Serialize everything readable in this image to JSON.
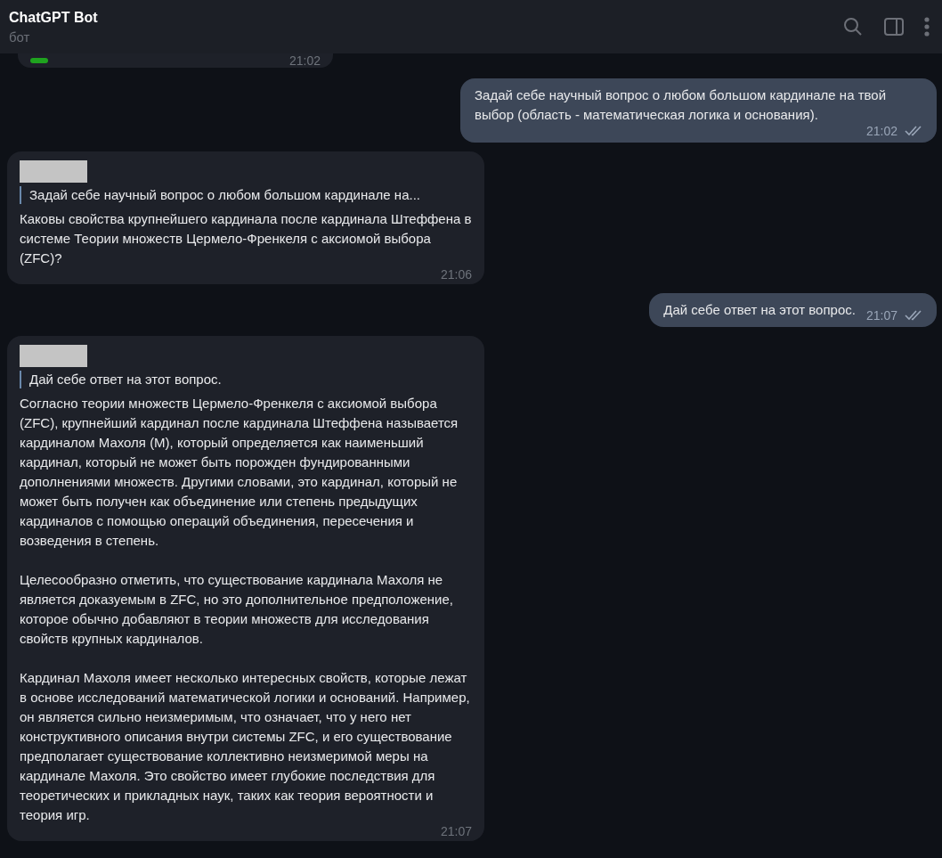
{
  "header": {
    "title": "ChatGPT Bot",
    "subtitle": "бот"
  },
  "messages": [
    {
      "kind": "partial",
      "time": "21:02"
    },
    {
      "kind": "outgoing",
      "text": "Задай себе научный вопрос о любом большом кардинале на твой выбор (область - математическая логика и основания).",
      "time": "21:02",
      "read": true
    },
    {
      "kind": "incoming",
      "reply_to": "Задай себе научный вопрос о любом большом кардинале на...",
      "paragraphs": [
        "Каковы свойства крупнейшего кардинала после кардинала Штеффена в системе Теории множеств Цермело-Френкеля с аксиомой выбора (ZFC)?"
      ],
      "time": "21:06"
    },
    {
      "kind": "outgoing",
      "text": "Дай себе ответ на этот вопрос.",
      "time": "21:07",
      "read": true
    },
    {
      "kind": "incoming",
      "reply_to": "Дай себе ответ на этот вопрос.",
      "paragraphs": [
        "Согласно теории множеств Цермело-Френкеля с аксиомой выбора (ZFC), крупнейший кардинал после кардинала Штеффена называется кардиналом Махоля (M), который определяется как наименьший кардинал, который не может быть порожден фундированными дополнениями множеств. Другими словами, это кардинал, который не может быть получен как объединение или степень предыдущих кардиналов с помощью операций объединения, пересечения и возведения в степень.",
        "Целесообразно отметить, что существование кардинала Махоля не является доказуемым в ZFC, но это дополнительное предположение, которое обычно добавляют в теории множеств для исследования свойств крупных кардиналов.",
        "Кардинал Махоля имеет несколько интересных свойств, которые лежат в основе исследований математической логики и оснований. Например, он является сильно неизмеримым, что означает, что у него нет конструктивного описания внутри системы ZFC, и его существование предполагает существование коллективно неизмеримой меры на кардинале Махоля. Это свойство имеет глубокие последствия для теоретических и прикладных наук, таких как теория вероятности и теория игр."
      ],
      "time": "21:07"
    }
  ]
}
